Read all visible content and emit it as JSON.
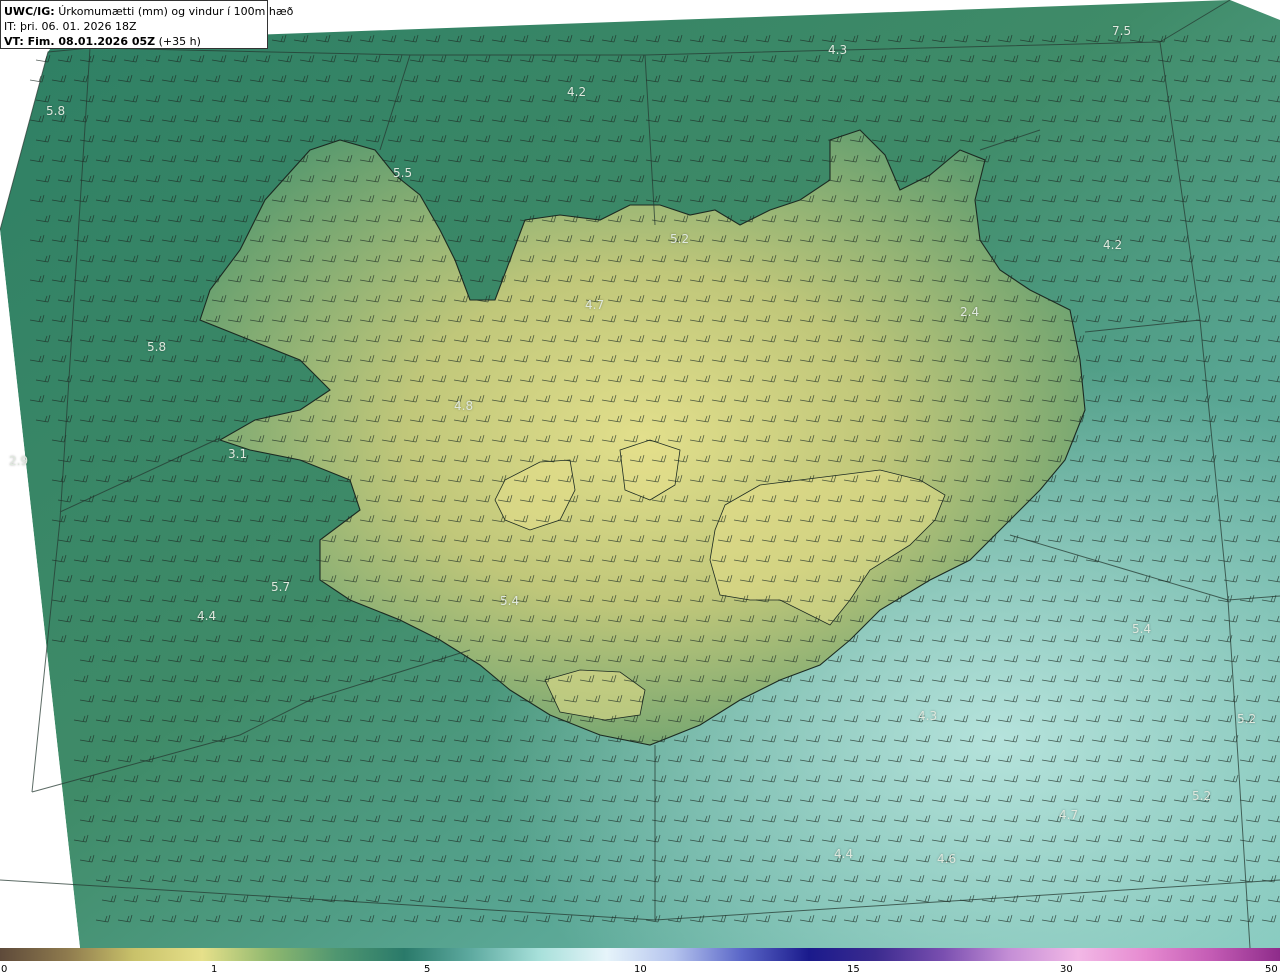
{
  "header": {
    "model_label": "UWC/IG:",
    "field_title": "Úrkomumætti (mm) og vindur í 100m hæð",
    "initial_time": "IT: þri. 06. 01. 2026 18Z",
    "valid_label": "VT: Fim. 08.01.2026 05Z",
    "forecast_hour": "(+35 h)"
  },
  "value_labels": [
    {
      "id": "ocean-ne-1",
      "text": "7.5"
    },
    {
      "id": "ocean-n-1",
      "text": "4.3"
    },
    {
      "id": "ocean-n-2",
      "text": "4.2"
    },
    {
      "id": "ocean-nw-1",
      "text": "5.8"
    },
    {
      "id": "westfjords-1",
      "text": "5.5"
    },
    {
      "id": "north-1",
      "text": "5.2"
    },
    {
      "id": "ocean-ne-2",
      "text": "4.2"
    },
    {
      "id": "north-2",
      "text": "4.7"
    },
    {
      "id": "east-1",
      "text": "2.4"
    },
    {
      "id": "ocean-w-1",
      "text": "5.8"
    },
    {
      "id": "west-1",
      "text": "4.8"
    },
    {
      "id": "ocean-w-2",
      "text": "2.9"
    },
    {
      "id": "snaefellsnes-1",
      "text": "3.1"
    },
    {
      "id": "ocean-sw-1",
      "text": "5.7"
    },
    {
      "id": "ocean-sw-2",
      "text": "4.4"
    },
    {
      "id": "south-1",
      "text": "5.4"
    },
    {
      "id": "ocean-se-1",
      "text": "5.4"
    },
    {
      "id": "ocean-s-1",
      "text": "4.3"
    },
    {
      "id": "ocean-se-2",
      "text": "5.2"
    },
    {
      "id": "ocean-se-3",
      "text": "5.2"
    },
    {
      "id": "ocean-se-4",
      "text": "4.7"
    },
    {
      "id": "ocean-s-2",
      "text": "4.4"
    },
    {
      "id": "ocean-s-3",
      "text": "4.6"
    }
  ],
  "colorbar": {
    "ticks": [
      "0",
      "1",
      "5",
      "10",
      "15",
      "30",
      "50"
    ],
    "colors": [
      "#5e4a3a",
      "#8f7b4e",
      "#c9c26a",
      "#e6e08a",
      "#8fb86f",
      "#4f9670",
      "#2a7a6a",
      "#5eaaa0",
      "#a7e0da",
      "#e6f4fa",
      "#b5c4ee",
      "#5b67c8",
      "#1a1a8c",
      "#3b2b8f",
      "#7a4fb0",
      "#c58fd6",
      "#f2b8e6",
      "#e68ad0",
      "#c35bb4",
      "#8e2c8a"
    ]
  }
}
